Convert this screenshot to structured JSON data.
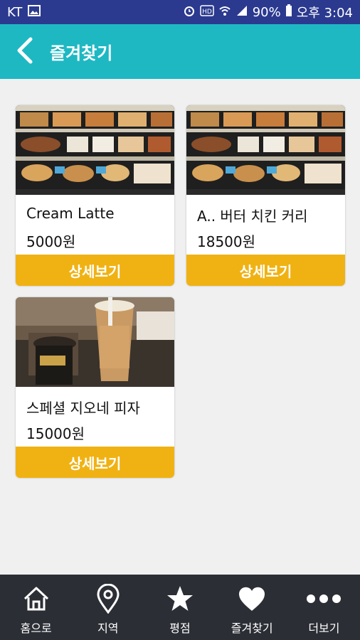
{
  "status_bar": {
    "carrier": "KT",
    "battery_percent": "90%",
    "time": "오후 3:04",
    "icons": [
      "image-icon",
      "alarm-icon",
      "hd-icon",
      "wifi-icon",
      "signal-icon",
      "battery-icon"
    ]
  },
  "header": {
    "title": "즐겨찾기",
    "back_icon": "chevron-left-icon"
  },
  "favorites": [
    {
      "name": "Cream Latte",
      "price": "5000원",
      "button_label": "상세보기",
      "photo": "bakery-display"
    },
    {
      "name": "A.. 버터 치킨 커리",
      "price": "18500원",
      "button_label": "상세보기",
      "photo": "bakery-display"
    },
    {
      "name": "스페셜 지오네 피자",
      "price": "15000원",
      "button_label": "상세보기",
      "photo": "iced-drinks"
    }
  ],
  "bottom_nav": {
    "items": [
      {
        "label": "홈으로",
        "icon": "home-icon"
      },
      {
        "label": "지역",
        "icon": "location-pin-icon"
      },
      {
        "label": "평점",
        "icon": "star-icon"
      },
      {
        "label": "즐겨찾기",
        "icon": "heart-icon"
      },
      {
        "label": "더보기",
        "icon": "more-dots-icon"
      }
    ]
  },
  "colors": {
    "status_bar": "#2b3a8f",
    "header": "#1eb8c3",
    "button": "#f0b213",
    "nav_bg": "#2b2e35"
  }
}
